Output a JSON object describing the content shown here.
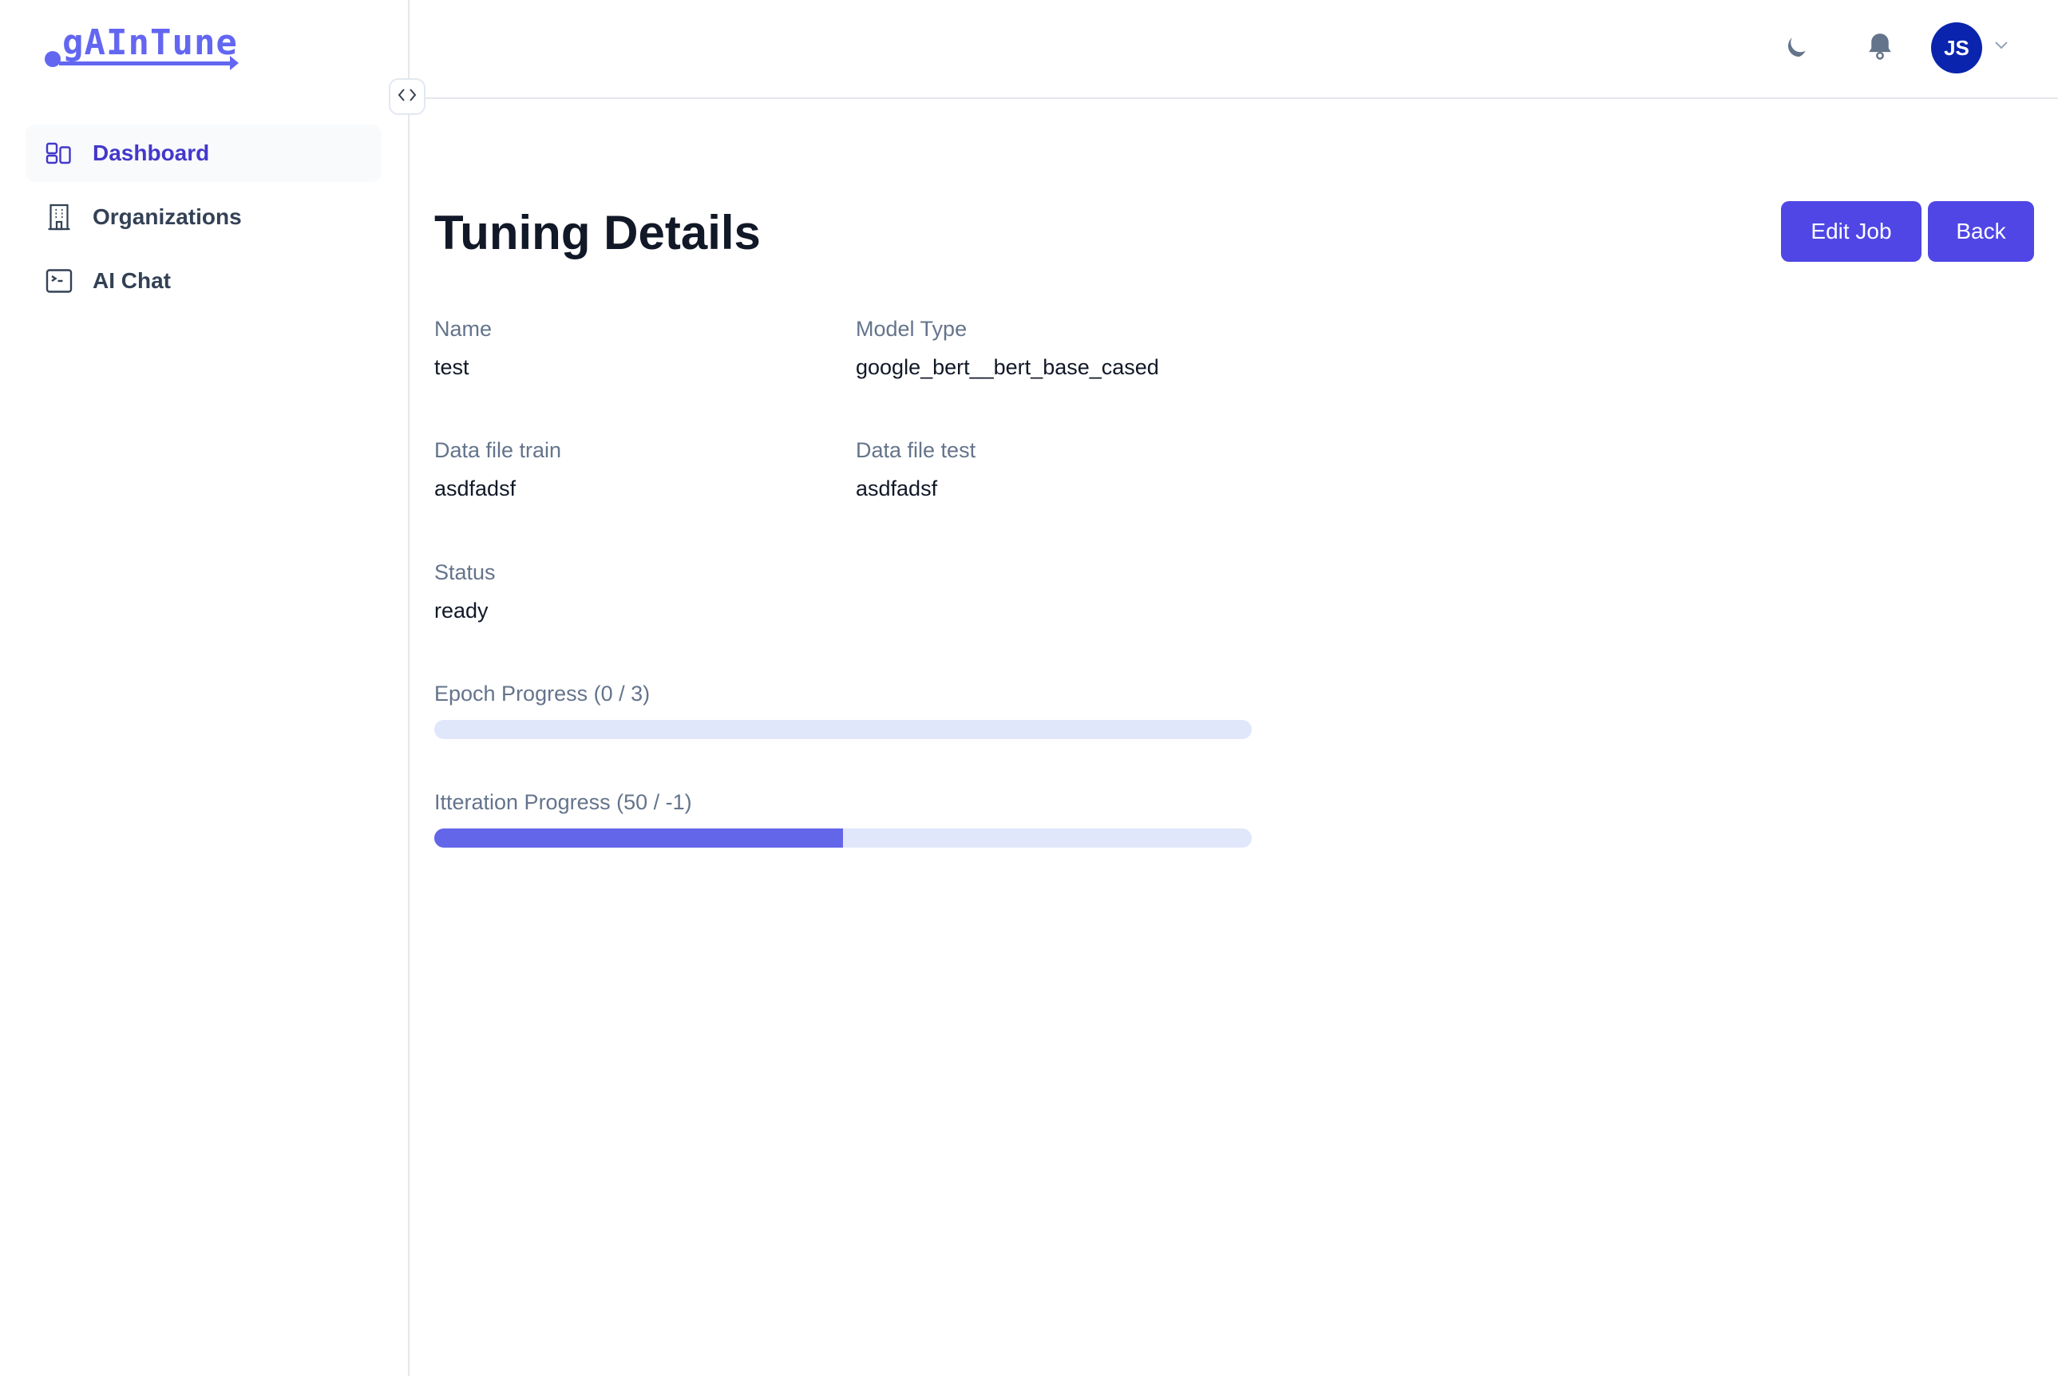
{
  "app": {
    "logo_text": "gAInTune",
    "brand_color": "#6366f1",
    "accent_color": "#4f46e5"
  },
  "sidebar": {
    "toggle_icon": "code-brackets-icon",
    "items": [
      {
        "label": "Dashboard",
        "icon": "dashboard-icon",
        "active": true
      },
      {
        "label": "Organizations",
        "icon": "building-icon",
        "active": false
      },
      {
        "label": "AI Chat",
        "icon": "terminal-icon",
        "active": false
      }
    ]
  },
  "header": {
    "theme_icon": "moon-icon",
    "notifications_icon": "bell-icon",
    "user_initials": "JS",
    "user_avatar_color": "#0b24ad",
    "user_menu_icon": "chevron-down-icon"
  },
  "main": {
    "title": "Tuning Details",
    "buttons": {
      "edit_job": "Edit Job",
      "back": "Back"
    },
    "fields": [
      {
        "label": "Name",
        "value": "test"
      },
      {
        "label": "Model Type",
        "value": "google_bert__bert_base_cased"
      },
      {
        "label": "Data file train",
        "value": "asdfadsf"
      },
      {
        "label": "Data file test",
        "value": "asdfadsf"
      },
      {
        "label": "Status",
        "value": "ready"
      }
    ],
    "progress": [
      {
        "label": "Epoch Progress (0 / 3)",
        "current": 0,
        "total": 3,
        "fill_percent": 0
      },
      {
        "label": "Itteration Progress (50 / -1)",
        "current": 50,
        "total": -1,
        "fill_percent": 50
      }
    ]
  }
}
